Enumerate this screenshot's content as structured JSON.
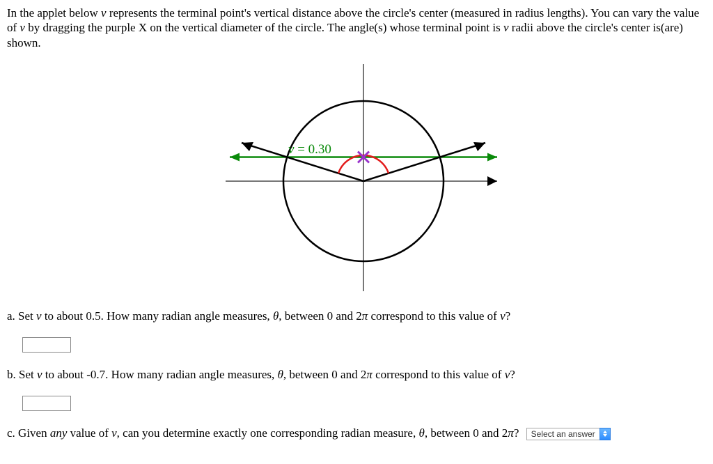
{
  "intro": {
    "part1": "In the applet below ",
    "v": "v",
    "part2": " represents the terminal point's vertical distance above the circle's center (measured in radius lengths). You can vary the value of ",
    "part3": " by dragging the purple X on the vertical diameter of the circle. The angle(s) whose terminal point is ",
    "part4": " radii above the circle's center is(are) shown."
  },
  "applet": {
    "v_label_prefix": "v",
    "v_label_eq": " = 0.30",
    "v_value": 0.3
  },
  "questions": {
    "a": {
      "label": "a. Set ",
      "mid": " to about 0.5. How many radian angle measures, ",
      "theta": "θ",
      "mid2": ", between 0 and 2",
      "pi": "π",
      "end": " correspond to this value of ",
      "q": "?"
    },
    "b": {
      "label": "b. Set ",
      "mid": " to about -0.7. How many radian angle measures, ",
      "theta": "θ",
      "mid2": ", between 0 and 2",
      "pi": "π",
      "end": " correspond to this value of ",
      "q": "?"
    },
    "c": {
      "label": "c. Given ",
      "any": "any",
      "mid": " value of ",
      "mid2": ", can you determine exactly one corresponding radian measure, ",
      "theta": "θ",
      "mid3": ", between 0 and 2",
      "pi": "π",
      "q": "?"
    }
  },
  "select": {
    "placeholder": "Select an answer"
  },
  "chart_data": {
    "type": "diagram",
    "description": "Unit circle with draggable vertical height v",
    "v": 0.3,
    "radius": 1,
    "angles_shown": 2,
    "horizontal_chord_at_v": 0.3,
    "terminal_rays_from_center_to_chord_intersections": true,
    "angle_arc": "small red arc between terminal rays near center",
    "axes": {
      "x": true,
      "y": true
    },
    "ylim": [
      -1,
      1
    ],
    "xlim": [
      -1,
      1
    ]
  }
}
